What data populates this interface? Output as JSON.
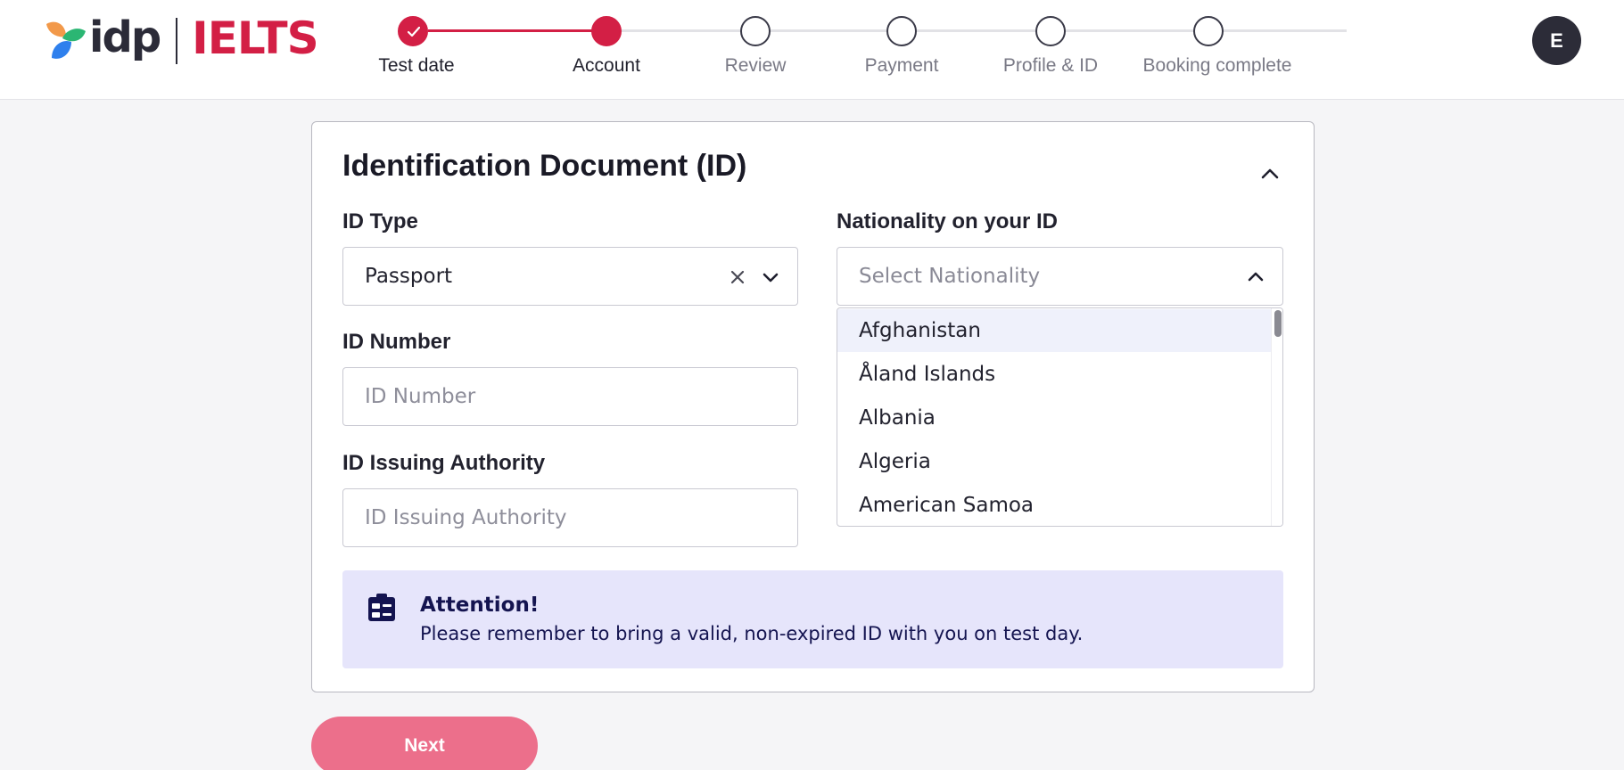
{
  "header": {
    "logo_idp": "idp",
    "logo_ielts": "IELTS",
    "avatar_initial": "E",
    "steps": [
      {
        "label": "Test date",
        "state": "done"
      },
      {
        "label": "Account",
        "state": "current"
      },
      {
        "label": "Review",
        "state": "pending"
      },
      {
        "label": "Payment",
        "state": "pending"
      },
      {
        "label": "Profile & ID",
        "state": "pending"
      },
      {
        "label": "Booking complete",
        "state": "pending"
      }
    ]
  },
  "card": {
    "title": "Identification Document (ID)",
    "id_type": {
      "label": "ID Type",
      "value": "Passport"
    },
    "id_number": {
      "label": "ID Number",
      "placeholder": "ID Number"
    },
    "id_authority": {
      "label": "ID Issuing Authority",
      "placeholder": "ID Issuing Authority"
    },
    "nationality": {
      "label": "Nationality on your ID",
      "placeholder": "Select Nationality",
      "options": [
        "Afghanistan",
        "Åland Islands",
        "Albania",
        "Algeria",
        "American Samoa"
      ]
    },
    "attention": {
      "title": "Attention!",
      "text": "Please remember to bring a valid, non-expired ID with you on test day."
    }
  },
  "actions": {
    "next_label": "Next"
  },
  "colors": {
    "brand_red": "#d31f45",
    "next_button": "#ec6f8b",
    "attention_bg": "#e6e5fb",
    "attention_text": "#141450"
  }
}
